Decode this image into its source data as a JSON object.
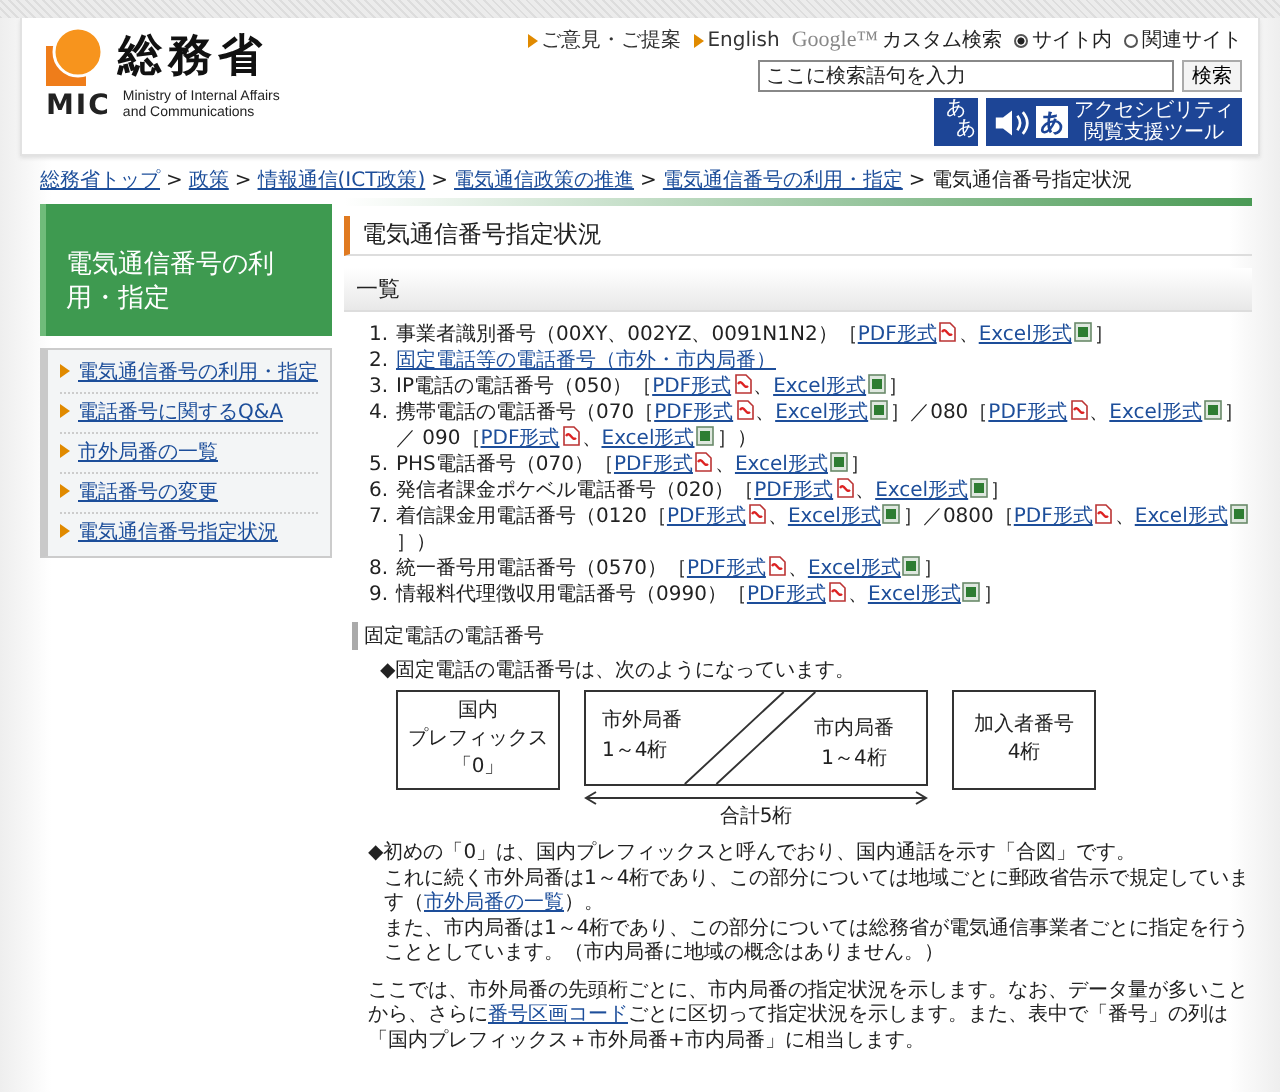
{
  "header": {
    "logo_name": "総務省",
    "logo_abbr": "MIC",
    "logo_subtitle": "Ministry of Internal Affairs and Communications",
    "links": [
      "ご意見・ご提案",
      "English"
    ],
    "search": {
      "brand": "Google™",
      "label": "カスタム検索",
      "scopes": [
        {
          "label": "サイト内",
          "selected": true
        },
        {
          "label": "関連サイト",
          "selected": false
        }
      ],
      "placeholder": "ここに検索語句を入力",
      "button": "検索"
    },
    "tools": {
      "font_size": [
        "あ",
        "あ"
      ],
      "reader_glyph": "あ",
      "reader_label": [
        "アクセシビリティ",
        "閲覧支援ツール"
      ]
    }
  },
  "breadcrumb": {
    "separator": ">",
    "links": [
      "総務省トップ",
      "政策",
      "情報通信(ICT政策)",
      "電気通信政策の推進",
      "電気通信番号の利用・指定"
    ],
    "current": "電気通信番号指定状況"
  },
  "sidebar": {
    "title": "電気通信番号の利用・指定",
    "items": [
      "電気通信番号の利用・指定",
      "電話番号に関するQ&A",
      "市外局番の一覧",
      "電話番号の変更",
      "電気通信番号指定状況"
    ]
  },
  "main": {
    "title": "電気通信番号指定状況",
    "list_heading": "一覧",
    "items": [
      {
        "number": "1.",
        "segments": [
          {
            "kind": "text",
            "text": "事業者識別番号（00XY、002YZ、0091N1N2）［"
          },
          {
            "kind": "pdf",
            "text": "PDF形式"
          },
          {
            "kind": "text",
            "text": "、"
          },
          {
            "kind": "excel",
            "text": "Excel形式"
          },
          {
            "kind": "text",
            "text": "］"
          }
        ]
      },
      {
        "number": "2.",
        "segments": [
          {
            "kind": "link",
            "text": "固定電話等の電話番号（市外・市内局番）"
          }
        ]
      },
      {
        "number": "3.",
        "segments": [
          {
            "kind": "text",
            "text": "IP電話の電話番号（050）［"
          },
          {
            "kind": "pdf",
            "text": "PDF形式"
          },
          {
            "kind": "text",
            "text": "、"
          },
          {
            "kind": "excel",
            "text": "Excel形式"
          },
          {
            "kind": "text",
            "text": "］"
          }
        ]
      },
      {
        "number": "4.",
        "segments": [
          {
            "kind": "text",
            "text": "携帯電話の電話番号（070［"
          },
          {
            "kind": "pdf",
            "text": "PDF形式"
          },
          {
            "kind": "text",
            "text": "、"
          },
          {
            "kind": "excel",
            "text": "Excel形式"
          },
          {
            "kind": "text",
            "text": "］／080［"
          },
          {
            "kind": "pdf",
            "text": "PDF形式"
          },
          {
            "kind": "text",
            "text": "、"
          },
          {
            "kind": "excel",
            "text": "Excel形式"
          },
          {
            "kind": "text",
            "text": "］／ 090［"
          },
          {
            "kind": "pdf",
            "text": "PDF形式"
          },
          {
            "kind": "text",
            "text": "、"
          },
          {
            "kind": "excel",
            "text": "Excel形式"
          },
          {
            "kind": "text",
            "text": "］）"
          }
        ]
      },
      {
        "number": "5.",
        "segments": [
          {
            "kind": "text",
            "text": "PHS電話番号（070）［"
          },
          {
            "kind": "pdf",
            "text": "PDF形式"
          },
          {
            "kind": "text",
            "text": "、"
          },
          {
            "kind": "excel",
            "text": "Excel形式"
          },
          {
            "kind": "text",
            "text": "］"
          }
        ]
      },
      {
        "number": "6.",
        "segments": [
          {
            "kind": "text",
            "text": "発信者課金ポケベル電話番号（020）［"
          },
          {
            "kind": "pdf",
            "text": "PDF形式"
          },
          {
            "kind": "text",
            "text": "、"
          },
          {
            "kind": "excel",
            "text": "Excel形式"
          },
          {
            "kind": "text",
            "text": "］"
          }
        ]
      },
      {
        "number": "7.",
        "segments": [
          {
            "kind": "text",
            "text": "着信課金用電話番号（0120［"
          },
          {
            "kind": "pdf",
            "text": "PDF形式"
          },
          {
            "kind": "text",
            "text": "、"
          },
          {
            "kind": "excel",
            "text": "Excel形式"
          },
          {
            "kind": "text",
            "text": "］／0800［"
          },
          {
            "kind": "pdf",
            "text": "PDF形式"
          },
          {
            "kind": "text",
            "text": "、"
          },
          {
            "kind": "excel",
            "text": "Excel形式"
          },
          {
            "kind": "text",
            "text": "］）"
          }
        ]
      },
      {
        "number": "8.",
        "segments": [
          {
            "kind": "text",
            "text": "統一番号用電話番号（0570）［"
          },
          {
            "kind": "pdf",
            "text": "PDF形式"
          },
          {
            "kind": "text",
            "text": "、"
          },
          {
            "kind": "excel",
            "text": "Excel形式"
          },
          {
            "kind": "text",
            "text": "］"
          }
        ]
      },
      {
        "number": "9.",
        "segments": [
          {
            "kind": "text",
            "text": "情報料代理徴収用電話番号（0990）［"
          },
          {
            "kind": "pdf",
            "text": "PDF形式"
          },
          {
            "kind": "text",
            "text": "、"
          },
          {
            "kind": "excel",
            "text": "Excel形式"
          },
          {
            "kind": "text",
            "text": "］"
          }
        ]
      }
    ],
    "section": {
      "heading": "固定電話の電話番号",
      "intro": "◆固定電話の電話番号は、次のようになっています。",
      "diagram": {
        "boxes": [
          {
            "kind": "box",
            "lines": [
              "国内",
              "プレフィックス",
              "「0」"
            ]
          },
          {
            "kind": "split",
            "left": [
              "市外局番",
              "1～4桁"
            ],
            "right": [
              "市内局番",
              "1～4桁"
            ]
          },
          {
            "kind": "box",
            "lines": [
              "加入者番号",
              "4桁"
            ]
          }
        ],
        "span_label": "合計5桁"
      },
      "paragraphs": [
        [
          [
            {
              "kind": "text",
              "text": "◆初めの「0」は、国内プレフィックスと呼んでおり、国内通話を示す「合図」です。"
            }
          ],
          [
            {
              "kind": "text",
              "text": "これに続く市外局番は1～4桁であり、この部分については地域ごとに郵政省告示で規定しています（"
            },
            {
              "kind": "link",
              "text": "市外局番の一覧"
            },
            {
              "kind": "text",
              "text": "）。"
            }
          ],
          [
            {
              "kind": "text",
              "text": "また、市内局番は1～4桁であり、この部分については総務省が電気通信事業者ごとに指定を行うこととしています。（市内局番に地域の概念はありません。）"
            }
          ]
        ],
        [
          [
            {
              "kind": "text",
              "text": "ここでは、市外局番の先頭桁ごとに、市内局番の指定状況を示します。なお、データ量が多いことから、さらに"
            },
            {
              "kind": "link",
              "text": "番号区画コード"
            },
            {
              "kind": "text",
              "text": "ごとに区切って指定状況を示します。また、表中で「番号」の列は「国内プレフィックス＋市外局番+市内局番」に相当します。"
            }
          ]
        ]
      ]
    }
  }
}
